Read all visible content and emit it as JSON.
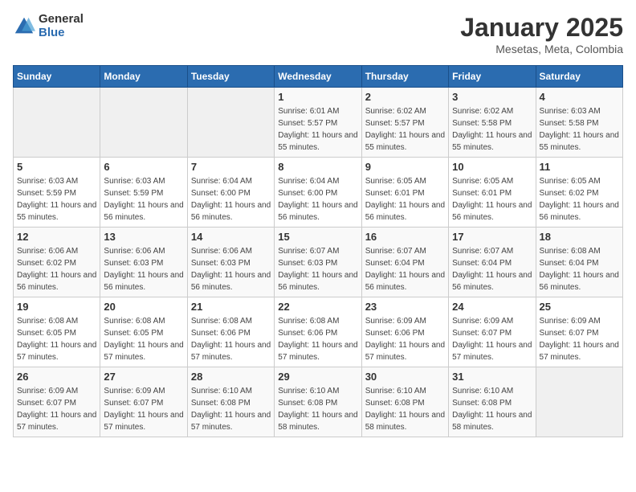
{
  "header": {
    "logo_general": "General",
    "logo_blue": "Blue",
    "month": "January 2025",
    "location": "Mesetas, Meta, Colombia"
  },
  "weekdays": [
    "Sunday",
    "Monday",
    "Tuesday",
    "Wednesday",
    "Thursday",
    "Friday",
    "Saturday"
  ],
  "weeks": [
    [
      {
        "day": "",
        "sunrise": "",
        "sunset": "",
        "daylight": ""
      },
      {
        "day": "",
        "sunrise": "",
        "sunset": "",
        "daylight": ""
      },
      {
        "day": "",
        "sunrise": "",
        "sunset": "",
        "daylight": ""
      },
      {
        "day": "1",
        "sunrise": "Sunrise: 6:01 AM",
        "sunset": "Sunset: 5:57 PM",
        "daylight": "Daylight: 11 hours and 55 minutes."
      },
      {
        "day": "2",
        "sunrise": "Sunrise: 6:02 AM",
        "sunset": "Sunset: 5:57 PM",
        "daylight": "Daylight: 11 hours and 55 minutes."
      },
      {
        "day": "3",
        "sunrise": "Sunrise: 6:02 AM",
        "sunset": "Sunset: 5:58 PM",
        "daylight": "Daylight: 11 hours and 55 minutes."
      },
      {
        "day": "4",
        "sunrise": "Sunrise: 6:03 AM",
        "sunset": "Sunset: 5:58 PM",
        "daylight": "Daylight: 11 hours and 55 minutes."
      }
    ],
    [
      {
        "day": "5",
        "sunrise": "Sunrise: 6:03 AM",
        "sunset": "Sunset: 5:59 PM",
        "daylight": "Daylight: 11 hours and 55 minutes."
      },
      {
        "day": "6",
        "sunrise": "Sunrise: 6:03 AM",
        "sunset": "Sunset: 5:59 PM",
        "daylight": "Daylight: 11 hours and 56 minutes."
      },
      {
        "day": "7",
        "sunrise": "Sunrise: 6:04 AM",
        "sunset": "Sunset: 6:00 PM",
        "daylight": "Daylight: 11 hours and 56 minutes."
      },
      {
        "day": "8",
        "sunrise": "Sunrise: 6:04 AM",
        "sunset": "Sunset: 6:00 PM",
        "daylight": "Daylight: 11 hours and 56 minutes."
      },
      {
        "day": "9",
        "sunrise": "Sunrise: 6:05 AM",
        "sunset": "Sunset: 6:01 PM",
        "daylight": "Daylight: 11 hours and 56 minutes."
      },
      {
        "day": "10",
        "sunrise": "Sunrise: 6:05 AM",
        "sunset": "Sunset: 6:01 PM",
        "daylight": "Daylight: 11 hours and 56 minutes."
      },
      {
        "day": "11",
        "sunrise": "Sunrise: 6:05 AM",
        "sunset": "Sunset: 6:02 PM",
        "daylight": "Daylight: 11 hours and 56 minutes."
      }
    ],
    [
      {
        "day": "12",
        "sunrise": "Sunrise: 6:06 AM",
        "sunset": "Sunset: 6:02 PM",
        "daylight": "Daylight: 11 hours and 56 minutes."
      },
      {
        "day": "13",
        "sunrise": "Sunrise: 6:06 AM",
        "sunset": "Sunset: 6:03 PM",
        "daylight": "Daylight: 11 hours and 56 minutes."
      },
      {
        "day": "14",
        "sunrise": "Sunrise: 6:06 AM",
        "sunset": "Sunset: 6:03 PM",
        "daylight": "Daylight: 11 hours and 56 minutes."
      },
      {
        "day": "15",
        "sunrise": "Sunrise: 6:07 AM",
        "sunset": "Sunset: 6:03 PM",
        "daylight": "Daylight: 11 hours and 56 minutes."
      },
      {
        "day": "16",
        "sunrise": "Sunrise: 6:07 AM",
        "sunset": "Sunset: 6:04 PM",
        "daylight": "Daylight: 11 hours and 56 minutes."
      },
      {
        "day": "17",
        "sunrise": "Sunrise: 6:07 AM",
        "sunset": "Sunset: 6:04 PM",
        "daylight": "Daylight: 11 hours and 56 minutes."
      },
      {
        "day": "18",
        "sunrise": "Sunrise: 6:08 AM",
        "sunset": "Sunset: 6:04 PM",
        "daylight": "Daylight: 11 hours and 56 minutes."
      }
    ],
    [
      {
        "day": "19",
        "sunrise": "Sunrise: 6:08 AM",
        "sunset": "Sunset: 6:05 PM",
        "daylight": "Daylight: 11 hours and 57 minutes."
      },
      {
        "day": "20",
        "sunrise": "Sunrise: 6:08 AM",
        "sunset": "Sunset: 6:05 PM",
        "daylight": "Daylight: 11 hours and 57 minutes."
      },
      {
        "day": "21",
        "sunrise": "Sunrise: 6:08 AM",
        "sunset": "Sunset: 6:06 PM",
        "daylight": "Daylight: 11 hours and 57 minutes."
      },
      {
        "day": "22",
        "sunrise": "Sunrise: 6:08 AM",
        "sunset": "Sunset: 6:06 PM",
        "daylight": "Daylight: 11 hours and 57 minutes."
      },
      {
        "day": "23",
        "sunrise": "Sunrise: 6:09 AM",
        "sunset": "Sunset: 6:06 PM",
        "daylight": "Daylight: 11 hours and 57 minutes."
      },
      {
        "day": "24",
        "sunrise": "Sunrise: 6:09 AM",
        "sunset": "Sunset: 6:07 PM",
        "daylight": "Daylight: 11 hours and 57 minutes."
      },
      {
        "day": "25",
        "sunrise": "Sunrise: 6:09 AM",
        "sunset": "Sunset: 6:07 PM",
        "daylight": "Daylight: 11 hours and 57 minutes."
      }
    ],
    [
      {
        "day": "26",
        "sunrise": "Sunrise: 6:09 AM",
        "sunset": "Sunset: 6:07 PM",
        "daylight": "Daylight: 11 hours and 57 minutes."
      },
      {
        "day": "27",
        "sunrise": "Sunrise: 6:09 AM",
        "sunset": "Sunset: 6:07 PM",
        "daylight": "Daylight: 11 hours and 57 minutes."
      },
      {
        "day": "28",
        "sunrise": "Sunrise: 6:10 AM",
        "sunset": "Sunset: 6:08 PM",
        "daylight": "Daylight: 11 hours and 57 minutes."
      },
      {
        "day": "29",
        "sunrise": "Sunrise: 6:10 AM",
        "sunset": "Sunset: 6:08 PM",
        "daylight": "Daylight: 11 hours and 58 minutes."
      },
      {
        "day": "30",
        "sunrise": "Sunrise: 6:10 AM",
        "sunset": "Sunset: 6:08 PM",
        "daylight": "Daylight: 11 hours and 58 minutes."
      },
      {
        "day": "31",
        "sunrise": "Sunrise: 6:10 AM",
        "sunset": "Sunset: 6:08 PM",
        "daylight": "Daylight: 11 hours and 58 minutes."
      },
      {
        "day": "",
        "sunrise": "",
        "sunset": "",
        "daylight": ""
      }
    ]
  ]
}
